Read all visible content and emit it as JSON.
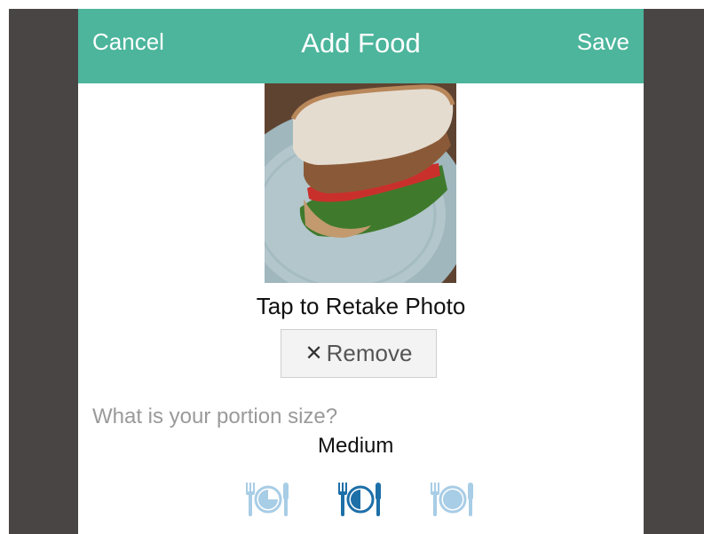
{
  "header": {
    "cancel_label": "Cancel",
    "title": "Add Food",
    "save_label": "Save"
  },
  "photo": {
    "retake_label": "Tap to Retake Photo"
  },
  "remove_button": {
    "icon": "close-icon",
    "label": "Remove"
  },
  "portion": {
    "question": "What is your portion size?",
    "selected_value": "Medium",
    "options": [
      {
        "icon": "portion-small-icon",
        "selected": false
      },
      {
        "icon": "portion-medium-icon",
        "selected": true
      },
      {
        "icon": "portion-large-icon",
        "selected": false
      }
    ]
  },
  "colors": {
    "header_bg": "#4cb59c",
    "frame_bg": "#4a4545",
    "icon_selected": "#1d6fa8",
    "icon_unselected": "#a8cde6"
  }
}
